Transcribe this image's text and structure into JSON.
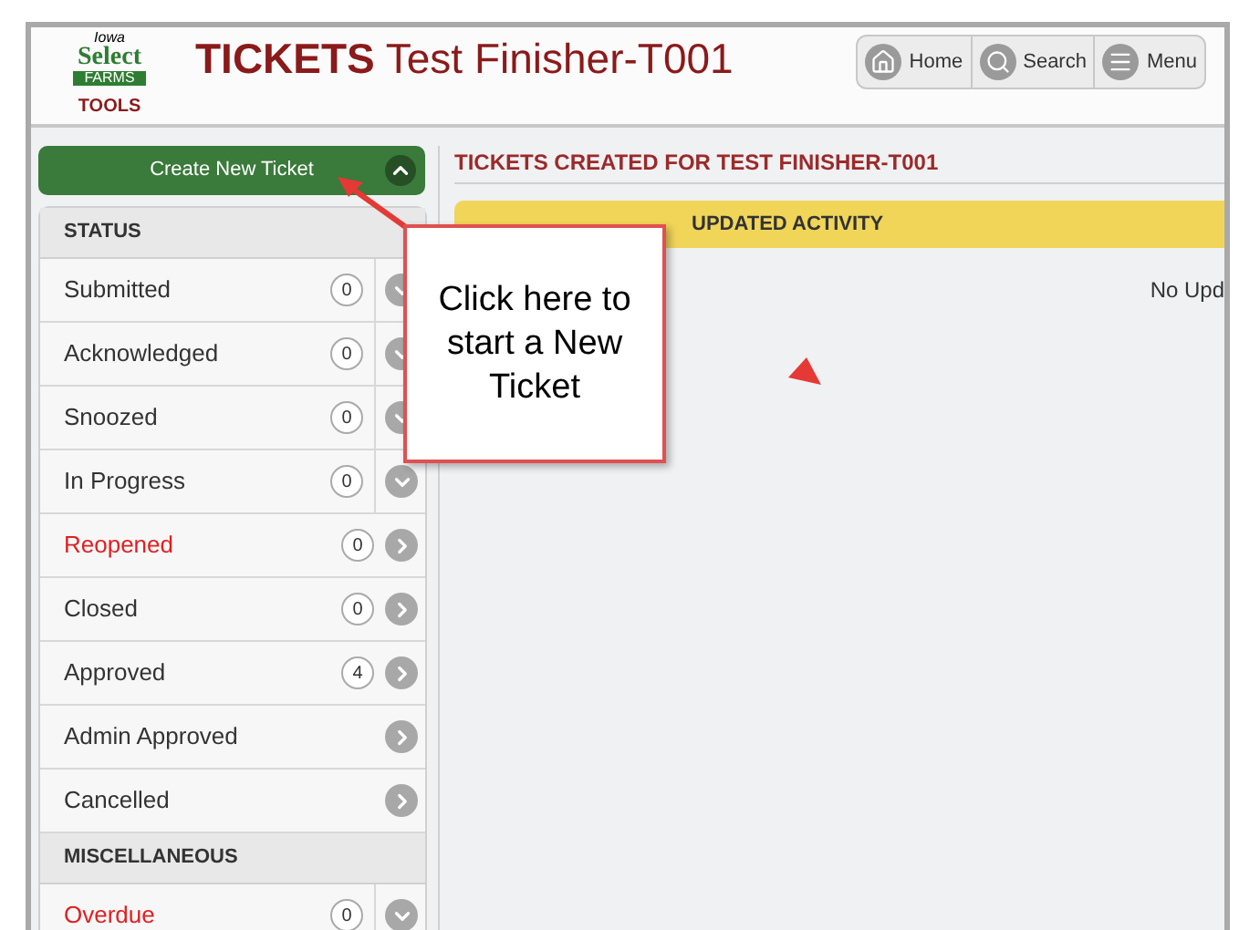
{
  "header": {
    "logo_top": "Iowa",
    "logo_main": "Select",
    "logo_sub": "FARMS",
    "logo_caption": "TOOLS",
    "title_bold": "TICKETS",
    "title_rest": "Test Finisher-T001",
    "nav": [
      {
        "label": "Home",
        "kind": "home"
      },
      {
        "label": "Search",
        "kind": "search"
      },
      {
        "label": "Menu",
        "kind": "menu"
      }
    ]
  },
  "sidebar": {
    "create_button": "Create New Ticket",
    "sections": [
      {
        "title": "STATUS",
        "items": [
          {
            "label": "Submitted",
            "count": "0",
            "alert": false,
            "kind": "dropdown"
          },
          {
            "label": "Acknowledged",
            "count": "0",
            "alert": false,
            "kind": "dropdown"
          },
          {
            "label": "Snoozed",
            "count": "0",
            "alert": false,
            "kind": "dropdown"
          },
          {
            "label": "In Progress",
            "count": "0",
            "alert": false,
            "kind": "dropdown"
          },
          {
            "label": "Reopened",
            "count": "0",
            "alert": true,
            "kind": "link"
          },
          {
            "label": "Closed",
            "count": "0",
            "alert": false,
            "kind": "link"
          },
          {
            "label": "Approved",
            "count": "4",
            "alert": false,
            "kind": "link"
          },
          {
            "label": "Admin Approved",
            "alert": false,
            "kind": "link"
          },
          {
            "label": "Cancelled",
            "alert": false,
            "kind": "link"
          }
        ]
      },
      {
        "title": "MISCELLANEOUS",
        "items": [
          {
            "label": "Overdue",
            "count": "0",
            "alert": true,
            "kind": "dropdown"
          }
        ]
      }
    ]
  },
  "main": {
    "heading": "TICKETS CREATED FOR TEST FINISHER-T001",
    "panel_title": "UPDATED ACTIVITY",
    "empty_text": "No Upd"
  },
  "callout": {
    "text": "Click here to start a New Ticket"
  }
}
